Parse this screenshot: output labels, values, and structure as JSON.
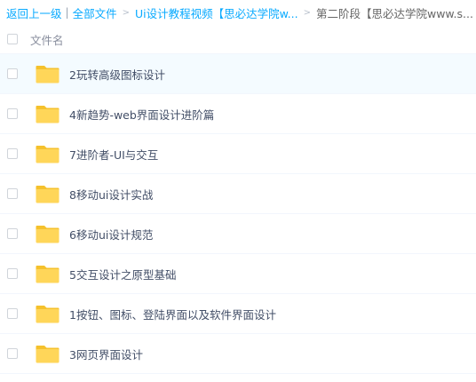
{
  "breadcrumb": {
    "back": "返回上一级",
    "separator": "|",
    "all_files": "全部文件",
    "arrow": ">",
    "course": "Ui设计教程视频【思必达学院w...",
    "current": "第二阶段【思必达学院www.s..."
  },
  "list_header": {
    "name_label": "文件名"
  },
  "files": [
    {
      "name": "2玩转高级图标设计",
      "icon": "folder-icon",
      "selected": true
    },
    {
      "name": "4新趋势-web界面设计进阶篇",
      "icon": "folder-icon",
      "selected": false
    },
    {
      "name": "7进阶者-UI与交互",
      "icon": "folder-icon",
      "selected": false
    },
    {
      "name": "8移动ui设计实战",
      "icon": "folder-icon",
      "selected": false
    },
    {
      "name": "6移动ui设计规范",
      "icon": "folder-icon",
      "selected": false
    },
    {
      "name": "5交互设计之原型基础",
      "icon": "folder-icon",
      "selected": false
    },
    {
      "name": "1按钮、图标、登陆界面以及软件界面设计",
      "icon": "folder-icon",
      "selected": false
    },
    {
      "name": "3网页界面设计",
      "icon": "folder-icon",
      "selected": false
    }
  ],
  "colors": {
    "link": "#09aaff",
    "folder_body": "#ffd659",
    "folder_tab": "#f5c12c",
    "selected_row": "#f4fbff"
  }
}
